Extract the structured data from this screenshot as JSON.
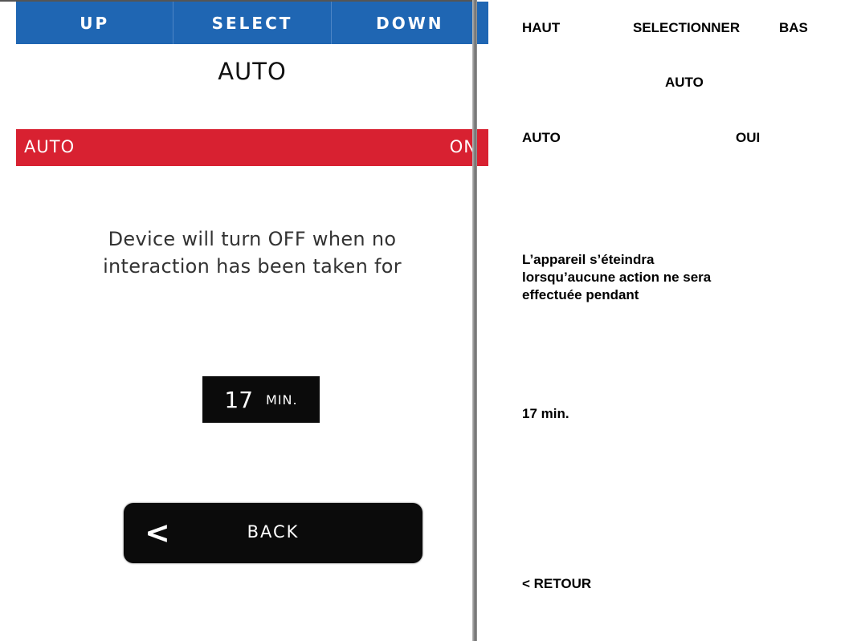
{
  "device": {
    "nav": {
      "up": "UP",
      "select": "SELECT",
      "down": "DOWN"
    },
    "title": "AUTO",
    "setting": {
      "name": "AUTO",
      "value": "ON"
    },
    "description_line1": "Device will turn OFF when no",
    "description_line2": "interaction has been taken for",
    "timer": {
      "value": "17",
      "unit": "MIN."
    },
    "back": {
      "icon": "chevron-left-icon",
      "label": "BACK"
    },
    "colors": {
      "nav": "#1f66b3",
      "setting_bar": "#d82131",
      "dark": "#0b0b0b"
    }
  },
  "translation": {
    "nav": {
      "up": "HAUT",
      "select": "SELECTIONNER",
      "down": "BAS"
    },
    "title": "AUTO",
    "setting": {
      "name": "AUTO",
      "value": "OUI"
    },
    "description_line1": "L’appareil s’éteindra",
    "description_line2": "lorsqu’aucune action ne sera",
    "description_line3": "effectuée pendant",
    "timer": "17 min.",
    "back": "< RETOUR"
  }
}
